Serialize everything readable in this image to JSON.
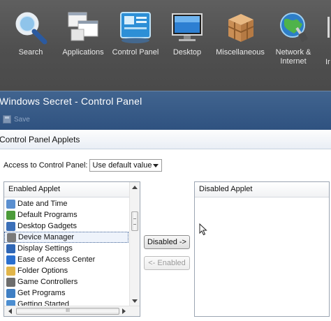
{
  "toolbar": {
    "items": [
      {
        "label": "Search",
        "icon": "magnifier-icon"
      },
      {
        "label": "Applications",
        "icon": "windows-icon"
      },
      {
        "label": "Control Panel",
        "icon": "control-panel-icon"
      },
      {
        "label": "Desktop",
        "icon": "monitor-icon"
      },
      {
        "label": "Miscellaneous",
        "icon": "crate-icon"
      },
      {
        "label": "Network &\nInternet",
        "icon": "globe-icon"
      },
      {
        "label": "Ir",
        "icon": "partial-icon"
      }
    ]
  },
  "window": {
    "title": "Windows Secret - Control Panel",
    "save_label": "Save"
  },
  "panel": {
    "title": "Control Panel Applets",
    "access_label": "Access to Control Panel:",
    "access_value": "Use default value"
  },
  "enabled_list": {
    "header": "Enabled Applet",
    "items": [
      {
        "label": "Date and Time",
        "icon": "clock-icon",
        "color": "#5a8fd0"
      },
      {
        "label": "Default Programs",
        "icon": "default-programs-icon",
        "color": "#4b9b3a"
      },
      {
        "label": "Desktop Gadgets",
        "icon": "gadgets-icon",
        "color": "#3b6fb8"
      },
      {
        "label": "Device Manager",
        "icon": "device-manager-icon",
        "color": "#7a7a7a",
        "selected": true
      },
      {
        "label": "Display Settings",
        "icon": "display-icon",
        "color": "#2f66b5"
      },
      {
        "label": "Ease of Access Center",
        "icon": "ease-of-access-icon",
        "color": "#2a6fcf"
      },
      {
        "label": "Folder Options",
        "icon": "folder-icon",
        "color": "#e1b54a"
      },
      {
        "label": "Game Controllers",
        "icon": "gamepad-icon",
        "color": "#6d6d6d"
      },
      {
        "label": "Get Programs",
        "icon": "get-programs-icon",
        "color": "#3f7fc4"
      },
      {
        "label": "Getting Started",
        "icon": "getting-started-icon",
        "color": "#4c8ed1"
      }
    ],
    "hscroll_grip": "III"
  },
  "disabled_list": {
    "header": "Disabled Applet",
    "items": []
  },
  "buttons": {
    "disable": "Disabled ->",
    "enable": "<- Enabled"
  }
}
